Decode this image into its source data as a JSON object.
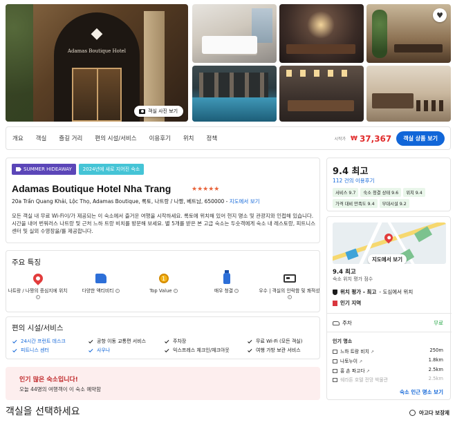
{
  "gallery": {
    "main_logo_text": "Adamas Boutique Hotel",
    "view_photos_label": "객실 사진 보기"
  },
  "nav": {
    "tabs": [
      "개요",
      "객실",
      "즐길 거리",
      "편의 시설/서비스",
      "이용후기",
      "위치",
      "정책"
    ],
    "from_label": "시작가",
    "currency": "₩",
    "price": "37,367",
    "view_rooms_button": "객실 상품 보기"
  },
  "hotel": {
    "badge_summer": "SUMMER HIDEAWAY",
    "badge_new": "2024년에 새로 지어진 숙소",
    "name": "Adamas Boutique Hotel Nha Trang",
    "stars": "★★★★★",
    "address": "20a Trần Quang Khải, Lộc Thọ, Adamas Boutique, 록토, 나트랑 / 나짱, 베트남, 650000 - ",
    "map_link": "지도에서 보기",
    "description": "모든 객실 내 무료 Wi-Fi이/가 제공되는 이 숙소에서 즐거운 여행을 시작하세요. 록토에 위치해 있어 현지 명소 및 관광지와 인접해 있습니다. 시간을 내어 번워러스 나트랑 및 근처 느하 트랑 비치를 방문해 보세요. 별 5개를 받은 본 고급 숙소는 두숫객에게 숙소 내 레스토랑, 피트니스 센터 및 실외 수영장을/를 제공합니다."
  },
  "features": {
    "title": "주요 특징",
    "items": [
      {
        "label": "나트랑 / 나짱의 중심지에 위치",
        "icon": "map-pin-icon"
      },
      {
        "label": "다양한 액티비티",
        "icon": "thumbs-up-icon"
      },
      {
        "label": "Top Value",
        "icon": "medal-icon"
      },
      {
        "label": "매우 청결",
        "icon": "spray-bottle-icon"
      },
      {
        "label": "우수 | 객실의 안락함 및 쾌적성",
        "icon": "bed-icon"
      }
    ]
  },
  "facilities": {
    "title": "편의 시설/서비스",
    "items": [
      {
        "label": "24시간 프런트 데스크",
        "highlight": true
      },
      {
        "label": "공항 이동 교통편 서비스",
        "highlight": false
      },
      {
        "label": "주차장",
        "highlight": false
      },
      {
        "label": "무료 Wi-Fi (모든 객실)",
        "highlight": false
      },
      {
        "label": "피트니스 센터",
        "highlight": true
      },
      {
        "label": "사우나",
        "highlight": true
      },
      {
        "label": "익스프레스 체크인/체크아웃",
        "highlight": false
      },
      {
        "label": "여행 가방 보관 서비스",
        "highlight": false
      }
    ]
  },
  "popular": {
    "title": "인기 많은 숙소입니다!",
    "subtitle": "오늘 44명의 여행객이 이 숙소 예약함"
  },
  "select_room_title": "객실을 선택하세요",
  "rating": {
    "score": "9.4 최고",
    "reviews_link": "112 건의 이용후기",
    "tags": [
      "서비스 9.7",
      "숙소 청결 상태 9.6",
      "위치 9.4",
      "가격 대비 만족도 9.4",
      "부대시설 9.2"
    ]
  },
  "location": {
    "map_button": "지도에서 보기",
    "score": "9.4 최고",
    "sub": "숙소 위치 평가 점수",
    "row1_bold": "위치 평가 - 최고",
    "row1_light": " - 도심에서 위치",
    "row2": "인기 지역",
    "parking": "주차",
    "parking_value": "무료",
    "popular_places_title": "인기 명소",
    "places": [
      {
        "name": "느하 트랑 비치",
        "distance": "250m"
      },
      {
        "name": "나토누이",
        "distance": "1.8km"
      },
      {
        "name": "홍 손 파고다",
        "distance": "2.5km"
      },
      {
        "name": "쉐라톤 호텔 전망 박물관",
        "distance": "2.5km"
      }
    ],
    "nearby_link": "숙소 인근 명소 보기"
  },
  "guarantee": "아고다 보장제",
  "colors": {
    "primary_blue": "#1166d8",
    "price_red": "#e12d2d",
    "star_orange": "#e8633a",
    "summer_purple": "#5b46b8",
    "new_teal": "#45c4d6",
    "free_green": "#2aa84a"
  }
}
